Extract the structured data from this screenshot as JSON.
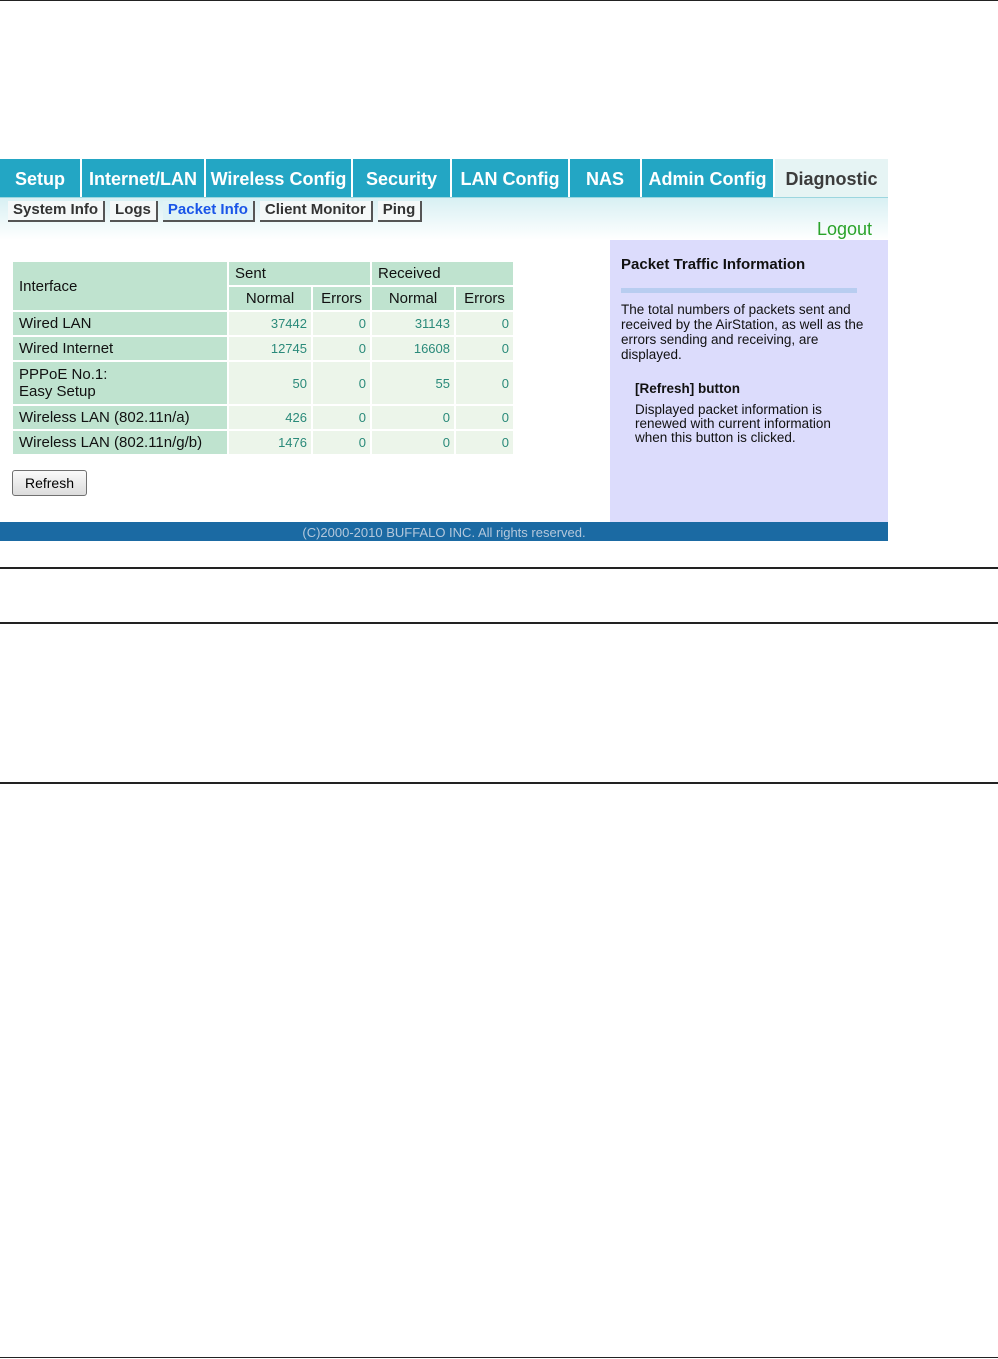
{
  "nav": {
    "tabs": [
      {
        "label": "Setup"
      },
      {
        "label": "Internet/LAN"
      },
      {
        "label": "Wireless Config"
      },
      {
        "label": "Security"
      },
      {
        "label": "LAN Config"
      },
      {
        "label": "NAS"
      },
      {
        "label": "Admin Config"
      },
      {
        "label": "Diagnostic"
      }
    ],
    "active": "Diagnostic"
  },
  "subnav": {
    "tabs": [
      {
        "label": "System Info"
      },
      {
        "label": "Logs"
      },
      {
        "label": "Packet Info"
      },
      {
        "label": "Client Monitor"
      },
      {
        "label": "Ping"
      }
    ],
    "active": "Packet Info",
    "logout_label": "Logout"
  },
  "table": {
    "header_interface": "Interface",
    "header_sent": "Sent",
    "header_received": "Received",
    "header_normal": "Normal",
    "header_errors": "Errors",
    "rows": [
      {
        "name": "Wired LAN",
        "sent_normal": "37442",
        "sent_errors": "0",
        "recv_normal": "31143",
        "recv_errors": "0"
      },
      {
        "name": "Wired Internet",
        "sent_normal": "12745",
        "sent_errors": "0",
        "recv_normal": "16608",
        "recv_errors": "0"
      },
      {
        "name_line1": "PPPoE No.1:",
        "name_line2": "Easy Setup",
        "sent_normal": "50",
        "sent_errors": "0",
        "recv_normal": "55",
        "recv_errors": "0"
      },
      {
        "name": "Wireless LAN (802.11n/a)",
        "sent_normal": "426",
        "sent_errors": "0",
        "recv_normal": "0",
        "recv_errors": "0"
      },
      {
        "name": "Wireless LAN (802.11n/g/b)",
        "sent_normal": "1476",
        "sent_errors": "0",
        "recv_normal": "0",
        "recv_errors": "0"
      }
    ]
  },
  "refresh_label": "Refresh",
  "help": {
    "title": "Packet Traffic Information",
    "text": "The total numbers of packets sent and received by the AirStation, as well as the errors sending and receiving, are displayed.",
    "button_title": "[Refresh] button",
    "button_text": "Displayed packet information is renewed with current information when this button is clicked."
  },
  "footer": "(C)2000-2010 BUFFALO INC. All rights reserved.",
  "colors": {
    "nav_tab": "#23a6c4",
    "active_subtab": "#1a55e8",
    "logout": "#2aa32a",
    "side_panel": "#dcdcfc",
    "footer": "#1b6aa3"
  }
}
